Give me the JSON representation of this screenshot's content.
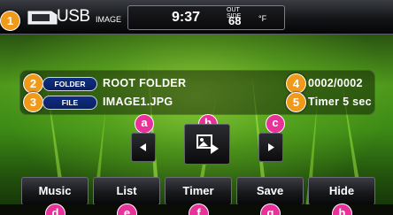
{
  "header": {
    "source_title": "USB",
    "source_subtitle": "IMAGE",
    "clock": "9:37",
    "outside_label_1": "OUT",
    "outside_label_2": "SIDE",
    "temperature": "68",
    "temperature_unit": "°F"
  },
  "info": {
    "folder_pill": "FOLDER",
    "folder_name": "ROOT FOLDER",
    "file_pill": "FILE",
    "file_name": "IMAGE1.JPG",
    "counter": "0002/0002",
    "timer": "Timer 5 sec"
  },
  "callouts": {
    "c1": "1",
    "c2": "2",
    "c3": "3",
    "c4": "4",
    "c5": "5",
    "a": "a",
    "b": "b",
    "c": "c",
    "d": "d",
    "e": "e",
    "f": "f",
    "g": "g",
    "h": "h"
  },
  "softkeys": {
    "music": "Music",
    "list": "List",
    "timer": "Timer",
    "save": "Save",
    "hide": "Hide"
  },
  "colors": {
    "callout_number": "#f09a1c",
    "callout_letter": "#e8329a",
    "pill_blue": "#0e2f88"
  },
  "icons": {
    "source": "usb-drive-icon",
    "prev": "triangle-left-icon",
    "slideshow": "slideshow-play-icon",
    "next": "triangle-right-icon"
  }
}
